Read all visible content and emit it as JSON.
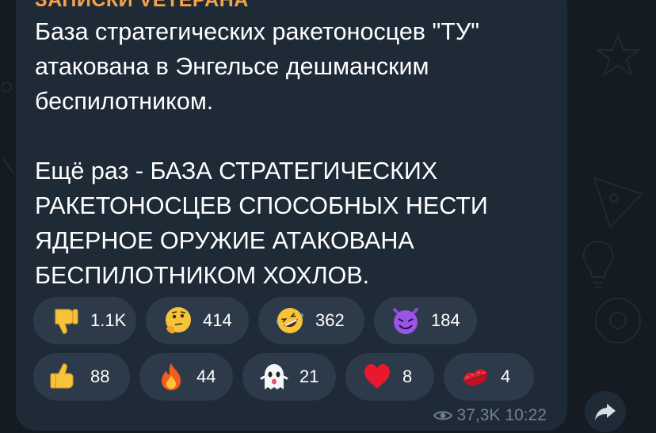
{
  "channel": {
    "name": "ЗАПИСКИ VETEPAHA"
  },
  "message": {
    "text": "База стратегических ракетоносцев \"ТУ\" атакована в Энгельсе дешманским беспилотником.\n\nЕщё раз - БАЗА СТРАТЕГИЧЕСКИХ РАКЕТОНОСЦЕВ СПОСОБНЫХ НЕСТИ ЯДЕРНОЕ ОРУЖИЕ АТАКОВАНА БЕСПИЛОТНИКОМ ХОХЛОВ."
  },
  "reactions": {
    "row1": [
      {
        "icon": "thumbs-down-icon",
        "count": "1.1K"
      },
      {
        "icon": "thinking-face-icon",
        "count": "414"
      },
      {
        "icon": "rolling-laughing-icon",
        "count": "362"
      },
      {
        "icon": "smiling-imp-icon",
        "count": "184"
      }
    ],
    "row2": [
      {
        "icon": "thumbs-up-icon",
        "count": "88"
      },
      {
        "icon": "fire-icon",
        "count": "44"
      },
      {
        "icon": "ghost-icon",
        "count": "21"
      },
      {
        "icon": "heart-icon",
        "count": "8"
      },
      {
        "icon": "kiss-mark-icon",
        "count": "4"
      }
    ]
  },
  "meta": {
    "views": "37,3K",
    "time": "10:22"
  },
  "colors": {
    "background": "#141b23",
    "bubble": "#1f2a37",
    "reaction_pill": "#2c3a49",
    "channel_name": "#f6a347",
    "meta_text": "#6f8195"
  }
}
